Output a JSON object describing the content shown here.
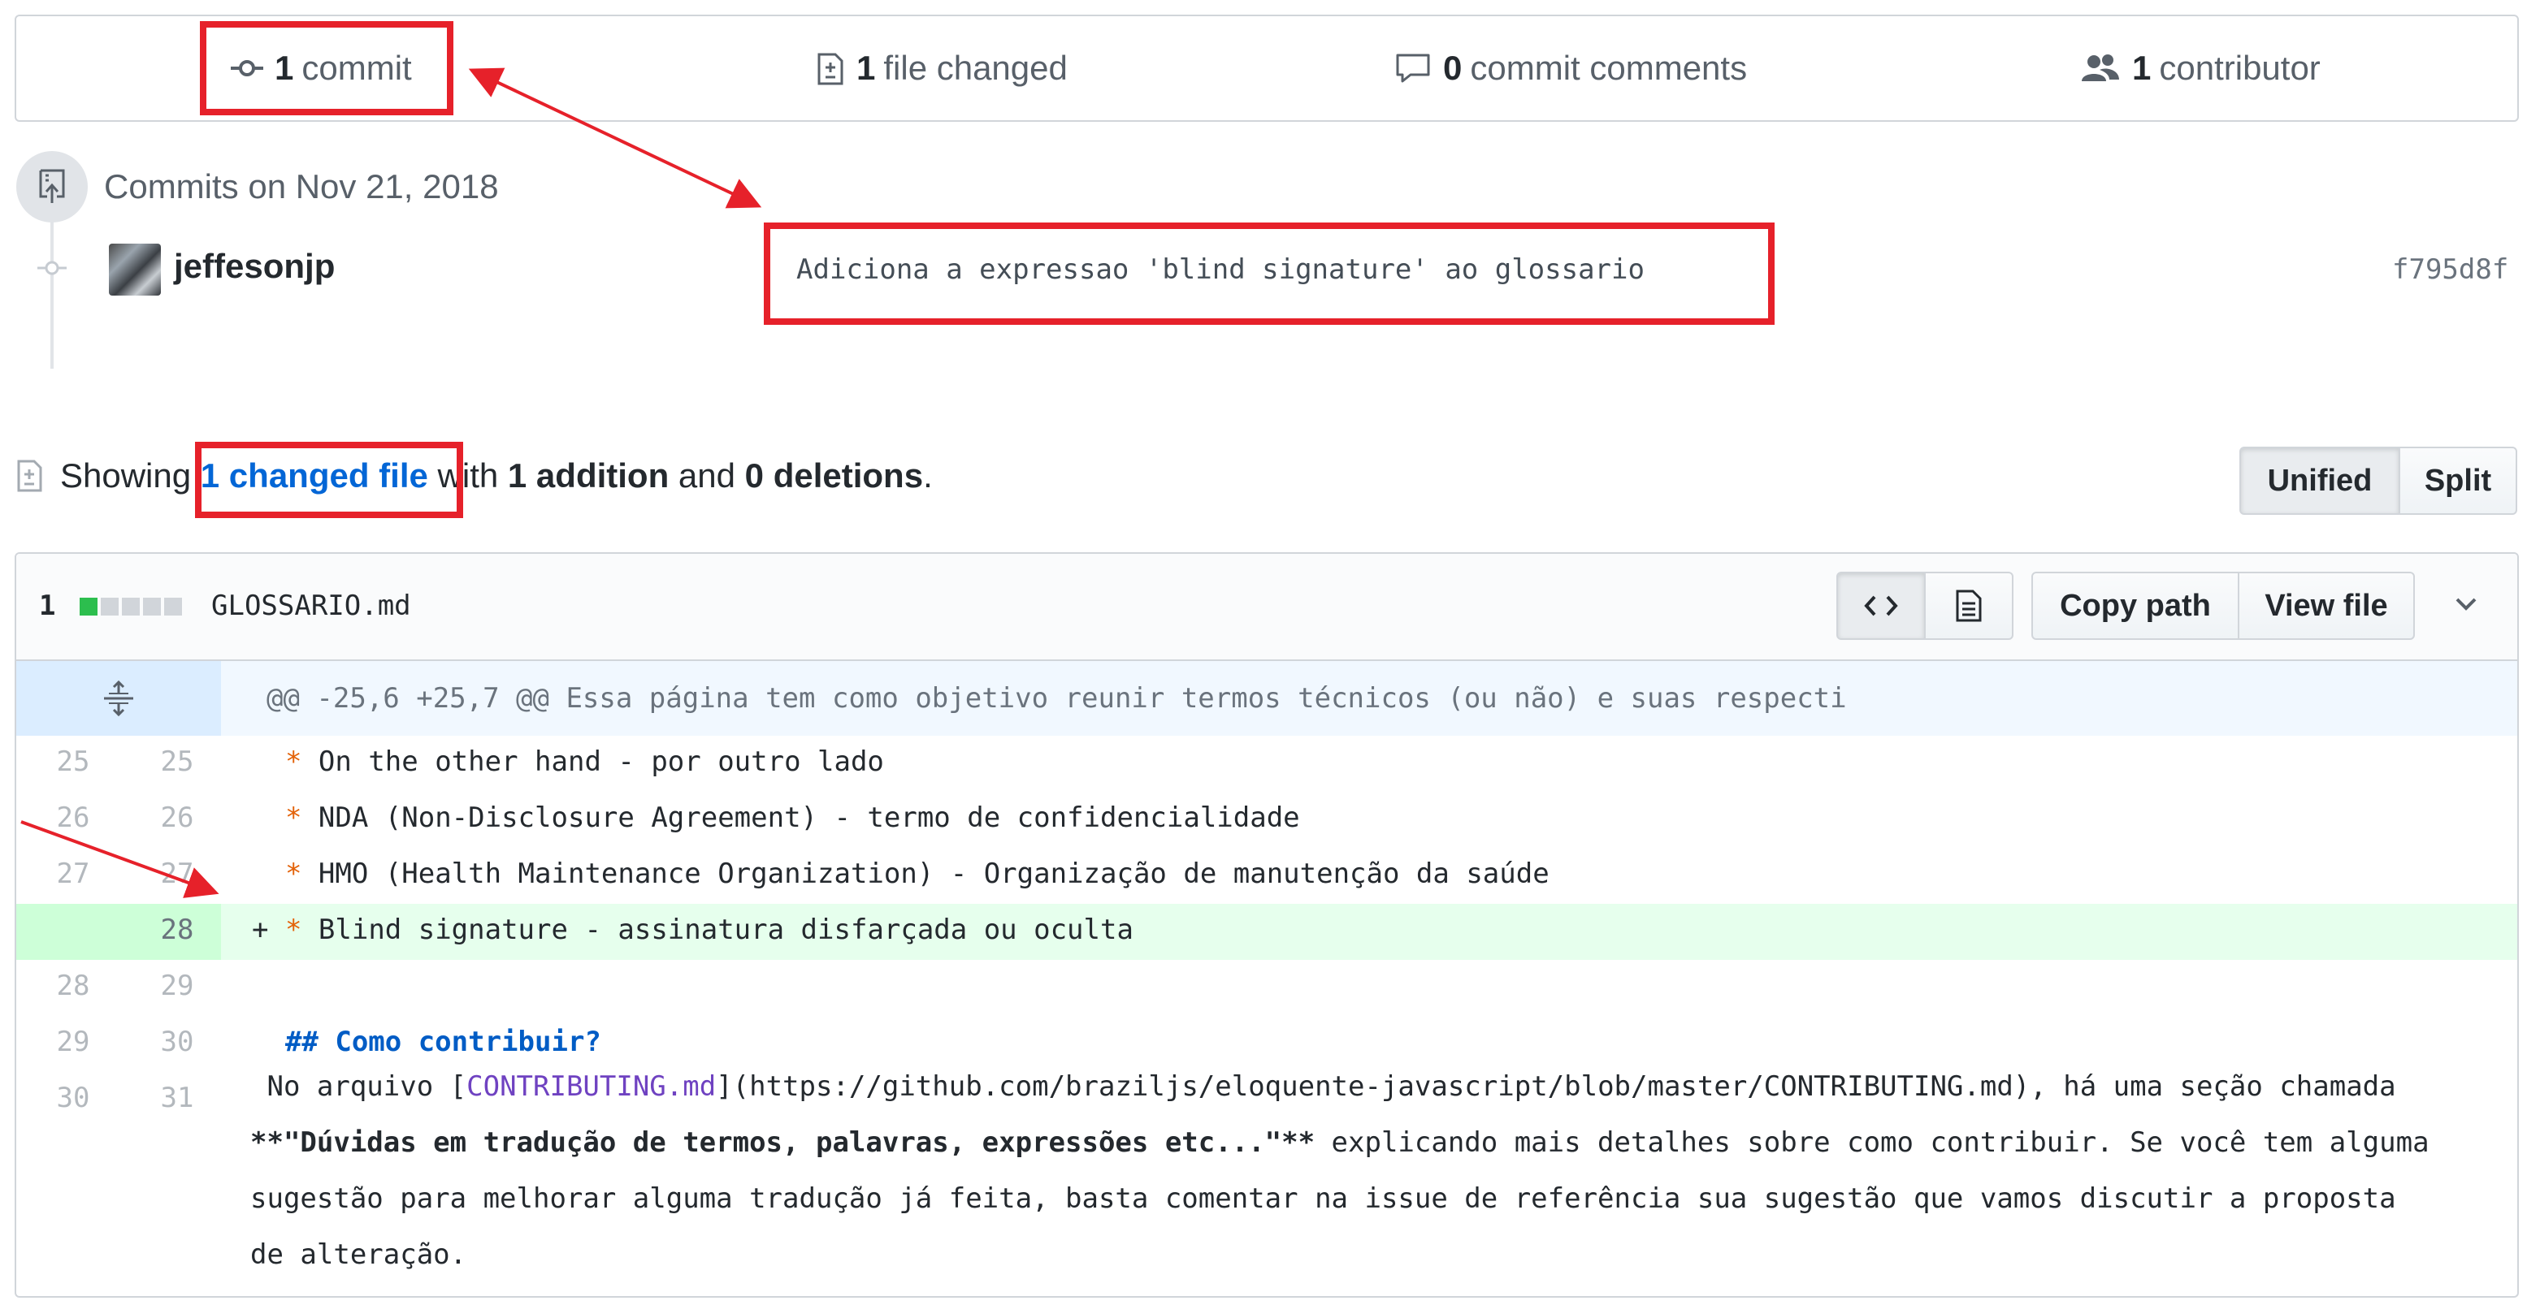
{
  "summary": {
    "commits": {
      "count": "1",
      "label": "commit"
    },
    "files": {
      "count": "1",
      "label": "file changed"
    },
    "comments": {
      "count": "0",
      "label": "commit comments"
    },
    "contributors": {
      "count": "1",
      "label": "contributor"
    }
  },
  "commits": {
    "date_header": "Commits on Nov 21, 2018",
    "author": "jeffesonjp",
    "message": "Adiciona a expressao 'blind signature' ao glossario",
    "sha": "f795d8f"
  },
  "showing": {
    "prefix": "Showing",
    "changed_files": "1 changed file",
    "with": "with",
    "additions": "1 addition",
    "and": "and",
    "deletions": "0 deletions",
    "suffix": "."
  },
  "view_toggle": {
    "unified": "Unified",
    "split": "Split",
    "selected": "Unified"
  },
  "file": {
    "diffstat": "1",
    "diffstat_blocks": {
      "added": 1,
      "neutral": 4
    },
    "name": "GLOSSARIO.md",
    "copy_path": "Copy path",
    "view_file": "View file",
    "hunk_header": "@@ -25,6 +25,7 @@ Essa página tem como objetivo reunir termos técnicos (ou não) e suas respecti",
    "lines": [
      {
        "old": "25",
        "new": "25",
        "marker": " ",
        "bullet": "*",
        "text": " On the other hand - por outro lado"
      },
      {
        "old": "26",
        "new": "26",
        "marker": " ",
        "bullet": "*",
        "text": " NDA (Non-Disclosure Agreement) - termo de confidencialidade"
      },
      {
        "old": "27",
        "new": "27",
        "marker": " ",
        "bullet": "*",
        "text": " HMO (Health Maintenance Organization) - Organização de manutenção da saúde"
      },
      {
        "old": "",
        "new": "28",
        "marker": "+",
        "bullet": "*",
        "text": " Blind signature - assinatura disfarçada ou oculta"
      },
      {
        "old": "28",
        "new": "29",
        "marker": " ",
        "bullet": "",
        "text": ""
      },
      {
        "old": "29",
        "new": "30",
        "marker": " ",
        "heading": "## Como contribuir?"
      },
      {
        "old": "30",
        "new": "31"
      }
    ],
    "paragraph": {
      "pre_link": "No arquivo [",
      "link_text": "CONTRIBUTING.md",
      "post_link": "](https://github.com/braziljs/eloquente-javascript/blob/master/CONTRIBUTING.md), há uma seção chamada ",
      "bold": "**\"Dúvidas em tradução de termos, palavras, expressões etc...\"**",
      "rest": " explicando mais detalhes sobre como contribuir. Se você tem alguma sugestão para melhorar alguma tradução já feita, basta comentar na issue de referência sua sugestão que vamos discutir a proposta de alteração."
    }
  },
  "colors": {
    "annotation": "#e6212a",
    "added_bg": "#e6ffed",
    "link": "#0366d6"
  }
}
